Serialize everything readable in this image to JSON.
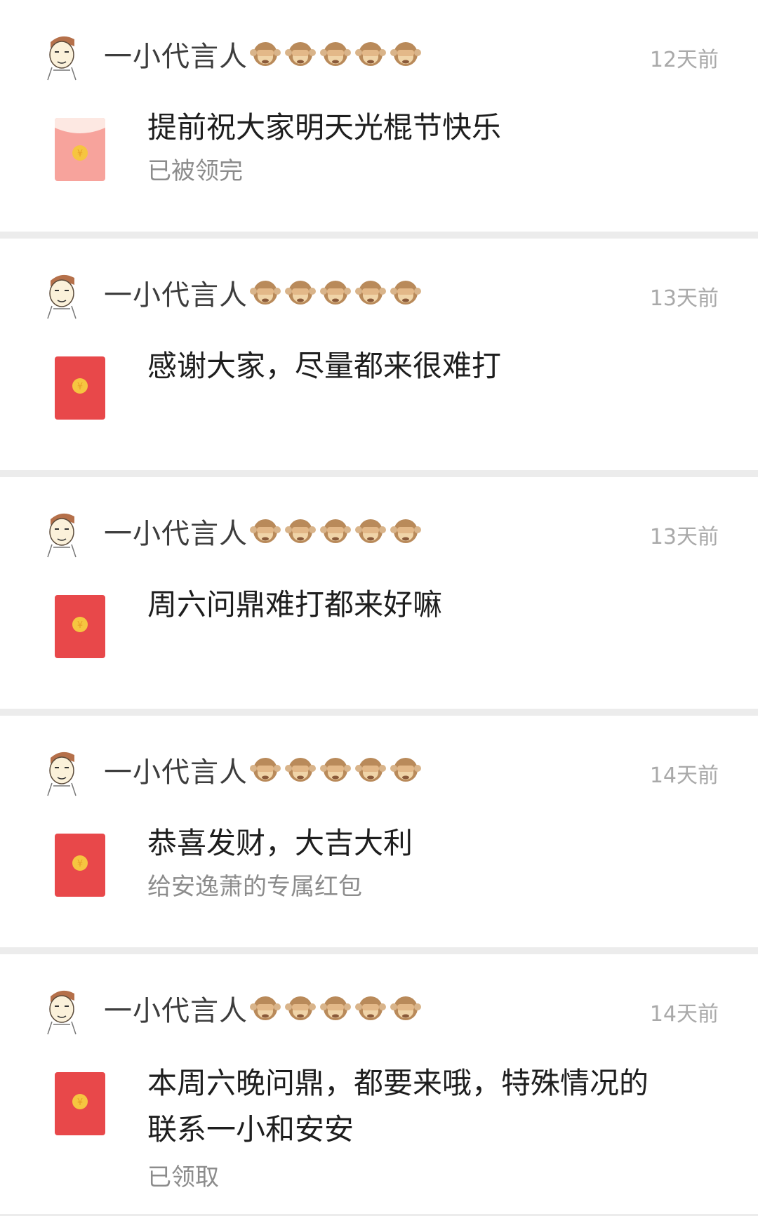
{
  "posts": [
    {
      "author": "一小代言人🙉🙉🙉🙉🙉",
      "author_name": "一小代言人",
      "time": "12天前",
      "message": "提前祝大家明天光棍节快乐",
      "status": "已被领完",
      "packet_state": "opened"
    },
    {
      "author_name": "一小代言人",
      "time": "13天前",
      "message": "感谢大家，尽量都来很难打",
      "status": "",
      "packet_state": "unopened"
    },
    {
      "author_name": "一小代言人",
      "time": "13天前",
      "message": "周六问鼎难打都来好嘛",
      "status": "",
      "packet_state": "unopened"
    },
    {
      "author_name": "一小代言人",
      "time": "14天前",
      "message": "恭喜发财，大吉大利",
      "status": "给安逸萧的专属红包",
      "packet_state": "unopened"
    },
    {
      "author_name": "一小代言人",
      "time": "14天前",
      "message_line1": "本周六晚问鼎，都要来哦，特殊情况的",
      "message_line2": "联系一小和安安",
      "status": "已领取",
      "packet_state": "unopened"
    }
  ],
  "icons": {
    "avatar": "cartoon-man-avatar-icon",
    "emoji": "see-no-evil-monkey-icon",
    "packet": "red-packet-icon",
    "currency": "yuan-sign"
  },
  "colors": {
    "packet_red": "#e8484a",
    "packet_opened": "#f7a39c",
    "coin_gold": "#f6c540"
  }
}
